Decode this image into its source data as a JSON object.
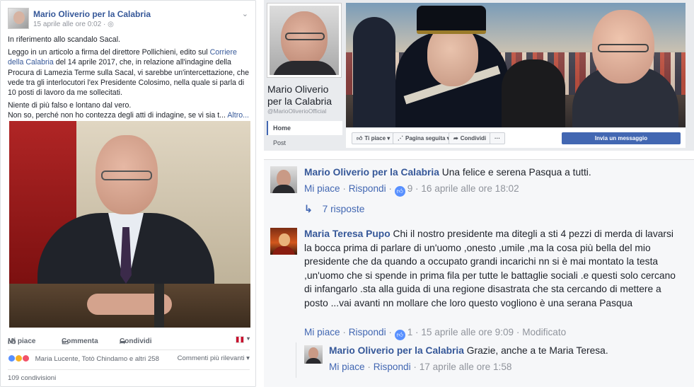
{
  "post": {
    "author": "Mario Oliverio per la Calabria",
    "time": "15 aprile alle ore 0:02 · ",
    "paragraphs": {
      "p1": "In riferimento allo scandalo Sacal.",
      "p2a": "Leggo in un articolo a firma del direttore Pollichieni, edito sul ",
      "p2link": "Corriere della Calabria",
      "p2b": " del 14 aprile 2017, che, in relazione all'indagine della Procura di Lamezia Terme sulla Sacal, vi sarebbe un'intercettazione, che vede tra gli interlocutori l'ex Presidente Colosimo, nella quale si parla di 10 posti di lavoro da me sollecitati.",
      "p3": "Niente di più falso e lontano dal vero.",
      "p4": "Non so, perché non ho contezza degli atti di indagine, se vi sia t...",
      "more": "Altro..."
    },
    "actions": {
      "like": "Mi piace",
      "comment": "Commenta",
      "share": "Condividi"
    },
    "reactions": {
      "names": "Maria Lucente, Totò Chindamo e altri 258",
      "sort": "Commenti più rilevanti"
    },
    "shares": "109 condivisioni"
  },
  "page": {
    "name": "Mario Oliverio per la Calabria",
    "handle": "@MarioOliverioOfficial",
    "nav": {
      "home": "Home",
      "post": "Post"
    },
    "actions": {
      "like": "Ti piace",
      "follow": "Pagina seguita",
      "share": "Condividi",
      "more": "···",
      "message": "Invia un messaggio"
    }
  },
  "comments": {
    "c1": {
      "author": "Mario Oliverio per la Calabria",
      "text": "Una felice e serena Pasqua a tutti.",
      "like": "Mi piace",
      "reply": "Rispondi",
      "likes": "9",
      "time": "16 aprile alle ore 18:02",
      "replies": "7 risposte"
    },
    "c2": {
      "author": "Maria Teresa Pupo",
      "text": "Chi il nostro presidente ma ditegli a sti 4 pezzi di merda di lavarsi la bocca prima di parlare di un'uomo ,onesto ,umile ,ma la cosa più bella del mio presidente che da quando a occupato grandi incarichi nn si è mai montato la testa ,un'uomo che si spende in prima fila per tutte le battaglie sociali .e questi solo cercano di infangarlo .sta alla guida di una regione disastrata che sta cercando di mettere a posto ...vai avanti nn mollare che loro questo vogliono è una serana Pasqua",
      "like": "Mi piace",
      "reply": "Rispondi",
      "likes": "1",
      "time": "15 aprile alle ore 9:09",
      "edited": "Modificato"
    },
    "c3": {
      "author": "Mario Oliverio per la Calabria",
      "text": "Grazie, anche a te Maria Teresa.",
      "like": "Mi piace",
      "reply": "Rispondi",
      "time": "17 aprile alle ore 1:58"
    }
  },
  "icons": {
    "like": "thumbs-up-icon",
    "comment": "speech-bubble-icon",
    "share": "share-arrow-icon",
    "globe": "globe-icon",
    "reply": "reply-arrow-icon",
    "rss": "rss-icon"
  },
  "colors": {
    "fb_blue": "#4267b2",
    "link": "#365899",
    "meta": "#90949c"
  }
}
